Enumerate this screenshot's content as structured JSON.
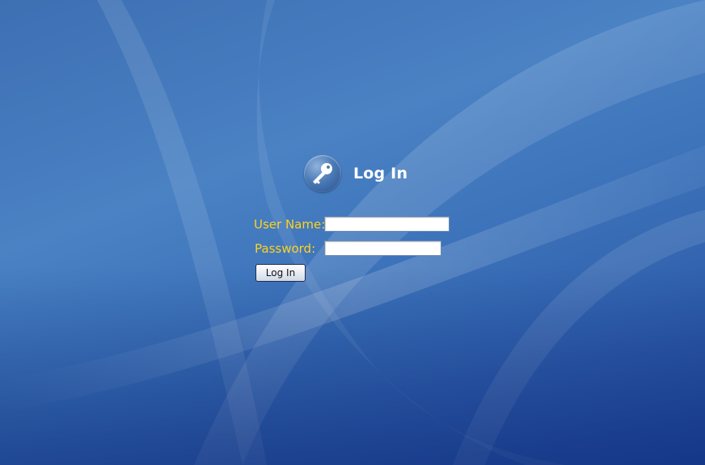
{
  "header": {
    "title": "Log In",
    "icon": "key-icon"
  },
  "form": {
    "username_label": "User Name:",
    "username_value": "",
    "password_label": "Password:",
    "password_value": "",
    "submit_label": "Log In"
  },
  "colors": {
    "label": "#ffd21e",
    "title": "#ffffff",
    "background": "#3a70b8"
  }
}
